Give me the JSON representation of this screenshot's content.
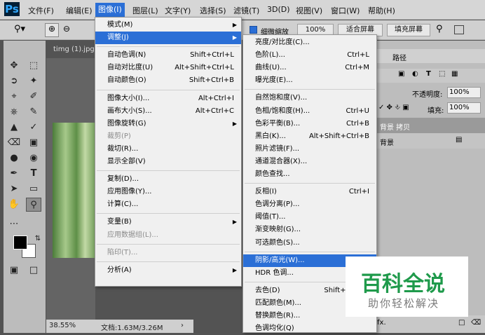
{
  "app": {
    "logo": "Ps"
  },
  "menubar": [
    "文件(F)",
    "编辑(E)",
    "图像(I)",
    "图层(L)",
    "文字(Y)",
    "选择(S)",
    "滤镜(T)",
    "3D(D)",
    "视图(V)",
    "窗口(W)",
    "帮助(H)"
  ],
  "options": {
    "fine_zoom_label": "细微缩放",
    "zoom_value": "100%",
    "fit_screen": "适合屏幕",
    "fill_screen": "填充屏幕"
  },
  "document": {
    "tab": "timg (1).jpg",
    "zoom": "38.55%",
    "doc_info": "文档:1.63M/3.26M"
  },
  "image_menu": [
    {
      "label": "模式(M)",
      "submenu": true
    },
    {
      "label": "调整(J)",
      "submenu": true,
      "highlighted": true
    },
    {
      "sep": true
    },
    {
      "label": "自动色调(N)",
      "shortcut": "Shift+Ctrl+L"
    },
    {
      "label": "自动对比度(U)",
      "shortcut": "Alt+Shift+Ctrl+L"
    },
    {
      "label": "自动颜色(O)",
      "shortcut": "Shift+Ctrl+B"
    },
    {
      "sep": true
    },
    {
      "label": "图像大小(I)...",
      "shortcut": "Alt+Ctrl+I"
    },
    {
      "label": "画布大小(S)...",
      "shortcut": "Alt+Ctrl+C"
    },
    {
      "label": "图像旋转(G)",
      "submenu": true
    },
    {
      "label": "裁剪(P)",
      "disabled": true
    },
    {
      "label": "裁切(R)..."
    },
    {
      "label": "显示全部(V)"
    },
    {
      "sep": true
    },
    {
      "label": "复制(D)..."
    },
    {
      "label": "应用图像(Y)..."
    },
    {
      "label": "计算(C)..."
    },
    {
      "sep": true
    },
    {
      "label": "变量(B)",
      "submenu": true
    },
    {
      "label": "应用数据组(L)...",
      "disabled": true
    },
    {
      "sep": true
    },
    {
      "label": "陷印(T)...",
      "disabled": true
    },
    {
      "sep": true
    },
    {
      "label": "分析(A)",
      "submenu": true
    }
  ],
  "adjust_menu": [
    {
      "label": "亮度/对比度(C)..."
    },
    {
      "label": "色阶(L)...",
      "shortcut": "Ctrl+L"
    },
    {
      "label": "曲线(U)...",
      "shortcut": "Ctrl+M"
    },
    {
      "label": "曝光度(E)..."
    },
    {
      "sep": true
    },
    {
      "label": "自然饱和度(V)..."
    },
    {
      "label": "色相/饱和度(H)...",
      "shortcut": "Ctrl+U"
    },
    {
      "label": "色彩平衡(B)...",
      "shortcut": "Ctrl+B"
    },
    {
      "label": "黑白(K)...",
      "shortcut": "Alt+Shift+Ctrl+B"
    },
    {
      "label": "照片滤镜(F)..."
    },
    {
      "label": "通道混合器(X)..."
    },
    {
      "label": "颜色查找..."
    },
    {
      "sep": true
    },
    {
      "label": "反相(I)",
      "shortcut": "Ctrl+I"
    },
    {
      "label": "色调分离(P)..."
    },
    {
      "label": "阈值(T)..."
    },
    {
      "label": "渐变映射(G)..."
    },
    {
      "label": "可选颜色(S)..."
    },
    {
      "sep": true
    },
    {
      "label": "阴影/高光(W)...",
      "highlighted": true
    },
    {
      "label": "HDR 色调..."
    },
    {
      "sep": true
    },
    {
      "label": "去色(D)",
      "shortcut": "Shift+Ctrl+U"
    },
    {
      "label": "匹配颜色(M)..."
    },
    {
      "label": "替换颜色(R)..."
    },
    {
      "label": "色调均化(Q)"
    }
  ],
  "panel": {
    "tab_paths": "路径",
    "opacity_label": "不透明度:",
    "opacity_value": "100%",
    "fill_label": "填充:",
    "fill_value": "100%",
    "layers": [
      "背景 拷贝",
      "背景"
    ]
  },
  "watermark": {
    "title": "百科全说",
    "subtitle": "助你轻松解决"
  }
}
